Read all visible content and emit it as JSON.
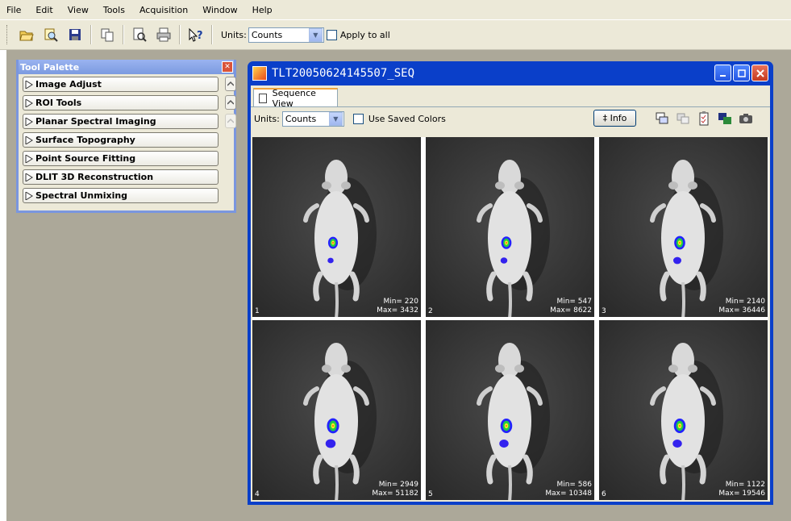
{
  "menu": [
    "File",
    "Edit",
    "View",
    "Tools",
    "Acquisition",
    "Window",
    "Help"
  ],
  "toolbar": {
    "icons": [
      "open-icon",
      "browse-icon",
      "save-icon",
      "copy-icon",
      "print-preview-icon",
      "print-icon",
      "help-icon"
    ],
    "units_label": "Units:",
    "units_value": "Counts",
    "apply_all_label": "Apply to all"
  },
  "palette": {
    "title": "Tool Palette",
    "items": [
      "Image Adjust",
      "ROI Tools",
      "Planar Spectral Imaging",
      "Surface Topography",
      "Point Source Fitting",
      "DLIT 3D Reconstruction",
      "Spectral Unmixing"
    ]
  },
  "seqwin": {
    "title": "TLT20050624145507_SEQ",
    "tab": "Sequence View",
    "units_label": "Units:",
    "units_value": "Counts",
    "saved_colors_label": "Use Saved Colors",
    "info_label": "‡ Info",
    "frames": [
      {
        "num": "1",
        "min": "Min= 220",
        "max": "Max= 3432",
        "signal": 0.35
      },
      {
        "num": "2",
        "min": "Min= 547",
        "max": "Max= 8622",
        "signal": 0.45
      },
      {
        "num": "3",
        "min": "Min= 2140",
        "max": "Max= 36446",
        "signal": 0.6
      },
      {
        "num": "4",
        "min": "Min= 2949",
        "max": "Max= 51182",
        "signal": 0.85
      },
      {
        "num": "5",
        "min": "Min= 586",
        "max": "Max= 10348",
        "signal": 0.75
      },
      {
        "num": "6",
        "min": "Min= 1122",
        "max": "Max= 19546",
        "signal": 0.75
      }
    ]
  }
}
